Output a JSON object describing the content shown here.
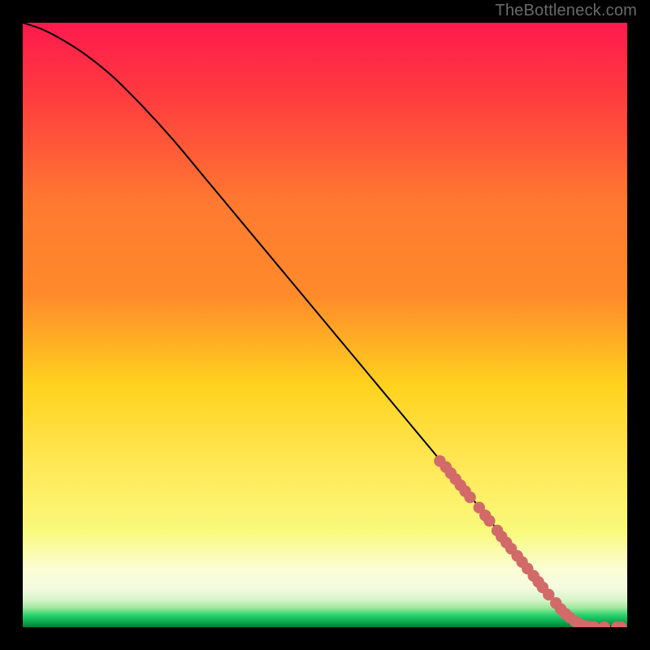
{
  "attribution": "TheBottleneck.com",
  "colors": {
    "page_bg": "#000000",
    "gradient_top": "#ff1a4d",
    "gradient_mid_upper": "#ff8a2b",
    "gradient_mid": "#ffd21e",
    "gradient_mid_lower": "#f9f97a",
    "gradient_low_pale": "#f4fbe0",
    "gradient_green_lt": "#9fe89b",
    "gradient_green": "#26d46e",
    "gradient_green_dk": "#0aa64c",
    "curve": "#000000",
    "marker_fill": "#d16a68",
    "marker_stroke": "#b64f4e"
  },
  "chart_data": {
    "type": "line",
    "title": "",
    "xlabel": "",
    "ylabel": "",
    "xlim": [
      0,
      100
    ],
    "ylim": [
      0,
      100
    ],
    "series": [
      {
        "name": "bottleneck-curve",
        "x": [
          0,
          3,
          6,
          10,
          15,
          20,
          25,
          30,
          35,
          40,
          45,
          50,
          55,
          60,
          65,
          70,
          75,
          79,
          81,
          83,
          85,
          87,
          89,
          91,
          93,
          95,
          97,
          100
        ],
        "y": [
          100,
          99,
          97.5,
          95,
          91,
          86,
          80.5,
          74.5,
          68.5,
          62.5,
          56.5,
          50.5,
          44.5,
          38.5,
          32.5,
          26.5,
          20.5,
          15.5,
          13,
          10.5,
          8,
          5.5,
          3.2,
          1.6,
          0.7,
          0.25,
          0.05,
          0
        ]
      }
    ],
    "markers": {
      "name": "highlighted-points",
      "points": [
        {
          "x": 69.0,
          "y": 27.5
        },
        {
          "x": 70.0,
          "y": 26.5
        },
        {
          "x": 70.8,
          "y": 25.5
        },
        {
          "x": 71.6,
          "y": 24.5
        },
        {
          "x": 72.4,
          "y": 23.5
        },
        {
          "x": 73.2,
          "y": 22.5
        },
        {
          "x": 74.0,
          "y": 21.5
        },
        {
          "x": 75.5,
          "y": 19.8
        },
        {
          "x": 76.5,
          "y": 18.5
        },
        {
          "x": 77.2,
          "y": 17.6
        },
        {
          "x": 78.5,
          "y": 16.0
        },
        {
          "x": 79.2,
          "y": 15.0
        },
        {
          "x": 80.0,
          "y": 14.0
        },
        {
          "x": 80.8,
          "y": 13.0
        },
        {
          "x": 81.8,
          "y": 11.8
        },
        {
          "x": 82.6,
          "y": 10.8
        },
        {
          "x": 83.5,
          "y": 9.7
        },
        {
          "x": 84.5,
          "y": 8.5
        },
        {
          "x": 85.3,
          "y": 7.5
        },
        {
          "x": 86.0,
          "y": 6.6
        },
        {
          "x": 87.0,
          "y": 5.4
        },
        {
          "x": 88.2,
          "y": 4.0
        },
        {
          "x": 89.0,
          "y": 3.0
        },
        {
          "x": 89.8,
          "y": 2.2
        },
        {
          "x": 90.5,
          "y": 1.6
        },
        {
          "x": 91.3,
          "y": 1.0
        },
        {
          "x": 92.0,
          "y": 0.6
        },
        {
          "x": 92.8,
          "y": 0.25
        },
        {
          "x": 93.6,
          "y": 0.1
        },
        {
          "x": 94.5,
          "y": 0.05
        },
        {
          "x": 96.2,
          "y": 0.02
        },
        {
          "x": 98.3,
          "y": 0.0
        },
        {
          "x": 99.0,
          "y": 0.0
        }
      ]
    }
  }
}
